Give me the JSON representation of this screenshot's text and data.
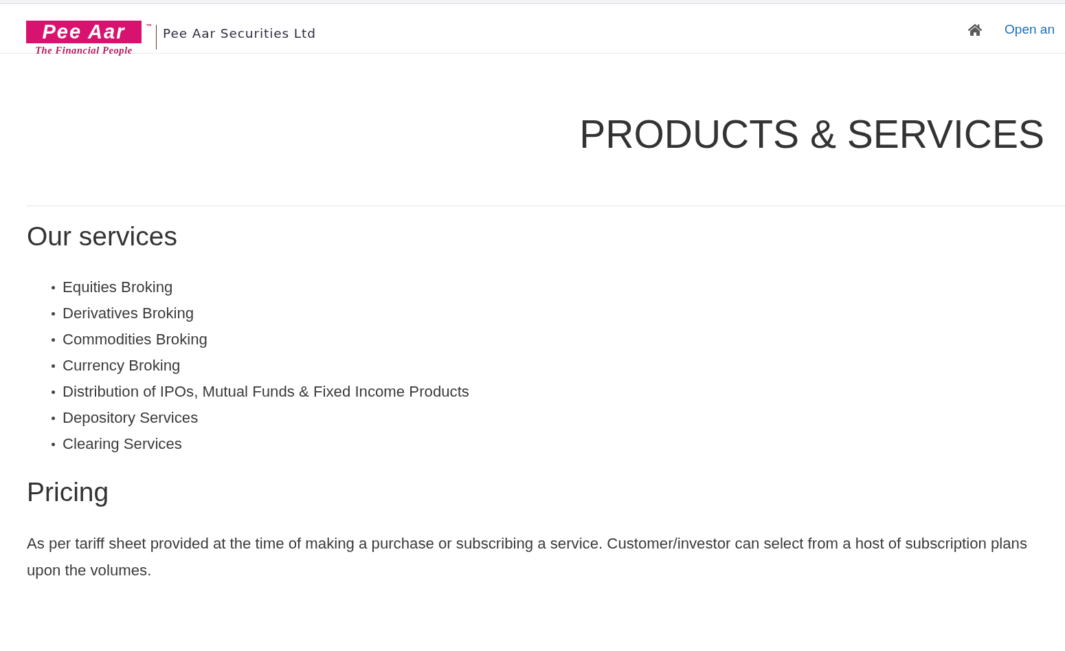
{
  "header": {
    "logo": {
      "wordmark": "Pee Aar",
      "trademark": "™",
      "tagline": "The Financial People"
    },
    "company_name": "Pee Aar Securities Ltd",
    "nav": {
      "link": "Open an"
    }
  },
  "page_title": "PRODUCTS & SERVICES",
  "sections": [
    {
      "kind": "list",
      "heading": "Our services",
      "items": [
        "Equities Broking",
        "Derivatives Broking",
        "Commodities Broking",
        "Currency Broking",
        "Distribution of IPOs, Mutual Funds & Fixed Income Products",
        "Depository Services",
        "Clearing Services"
      ]
    },
    {
      "kind": "paragraph",
      "heading": "Pricing",
      "lines": [
        "As per tariff sheet provided at the time of making a purchase or subscribing a service. Customer/investor can select from a host of subscription plans",
        "upon the volumes."
      ]
    }
  ]
}
